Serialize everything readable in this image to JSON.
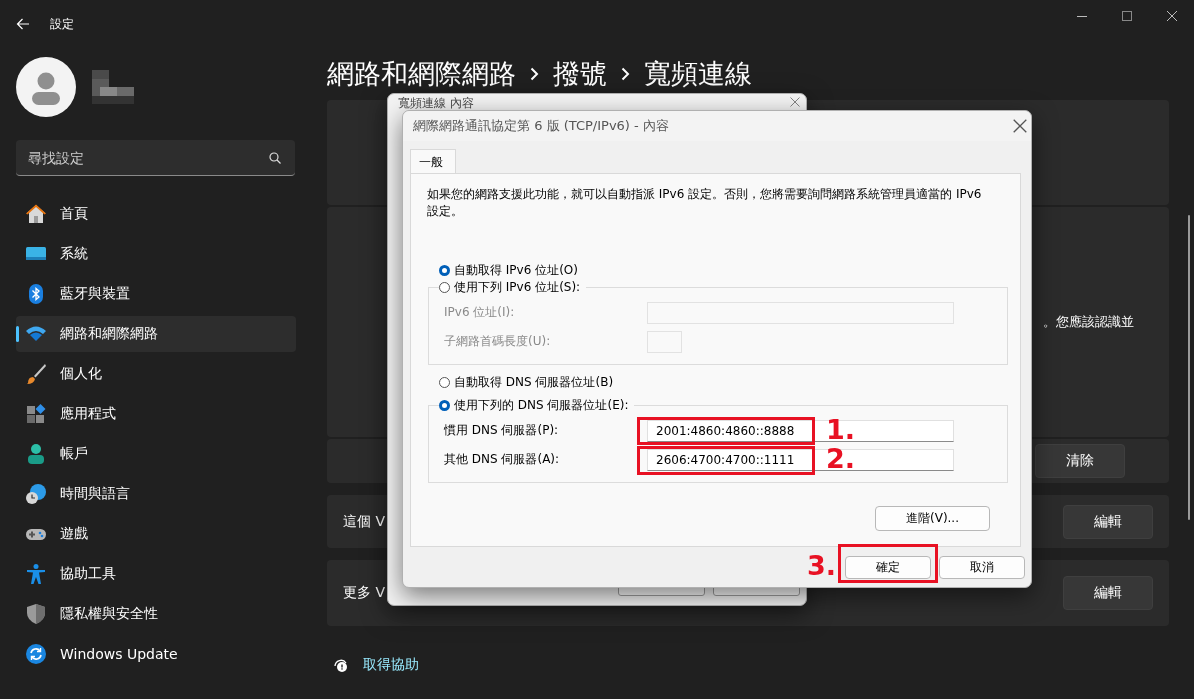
{
  "window": {
    "title": "設定"
  },
  "sidebar": {
    "search": {
      "placeholder": "尋找設定"
    },
    "items": [
      {
        "label": "首頁",
        "selected": false
      },
      {
        "label": "系統",
        "selected": false
      },
      {
        "label": "藍牙與裝置",
        "selected": false
      },
      {
        "label": "網路和網際網路",
        "selected": true
      },
      {
        "label": "個人化",
        "selected": false
      },
      {
        "label": "應用程式",
        "selected": false
      },
      {
        "label": "帳戶",
        "selected": false
      },
      {
        "label": "時間與語言",
        "selected": false
      },
      {
        "label": "遊戲",
        "selected": false
      },
      {
        "label": "協助工具",
        "selected": false
      },
      {
        "label": "隱私權與安全性",
        "selected": false
      },
      {
        "label": "Windows Update",
        "selected": false
      }
    ]
  },
  "breadcrumb": [
    "網路和網際網路",
    "撥號",
    "寬頻連線"
  ],
  "cards": [
    {
      "text": "。您應該認識並"
    },
    {
      "button": "清除"
    },
    {
      "text": "這個 V",
      "button": "編輯"
    },
    {
      "text": "更多 V",
      "button": "編輯"
    }
  ],
  "help_link": "取得協助",
  "back_dialog": {
    "title": "寬頻連線 內容"
  },
  "dialog": {
    "title": "網際網路通訊協定第 6 版 (TCP/IPv6) - 內容",
    "tabs": [
      {
        "label": "一般",
        "selected": true
      }
    ],
    "description": "如果您的網路支援此功能，就可以自動指派 IPv6 設定。否則，您將需要詢問網路系統管理員適當的 IPv6 設定。",
    "ip_auto": {
      "label": "自動取得 IPv6 位址(O)",
      "selected": true
    },
    "ip_manual": {
      "label": "使用下列 IPv6 位址(S):",
      "selected": false,
      "fields": [
        {
          "label": "IPv6 位址(I):",
          "kind": "wide",
          "disabled": true
        },
        {
          "label": "子網路首碼長度(U):",
          "kind": "short",
          "disabled": true
        }
      ]
    },
    "dns_auto": {
      "label": "自動取得 DNS 伺服器位址(B)",
      "selected": false
    },
    "dns_manual": {
      "label": "使用下列的 DNS 伺服器位址(E):",
      "selected": true,
      "fields": [
        {
          "label": "慣用 DNS 伺服器(P):",
          "kind": "wide",
          "disabled": false,
          "value": "2001:4860:4860::8888",
          "annotation": "1."
        },
        {
          "label": "其他 DNS 伺服器(A):",
          "kind": "wide",
          "disabled": false,
          "value": "2606:4700:4700::1111",
          "annotation": "2."
        }
      ]
    },
    "advanced_button": {
      "label": "進階(V)..."
    },
    "buttons": [
      {
        "label": "確定",
        "annotation": "3."
      },
      {
        "label": "取消"
      }
    ]
  }
}
